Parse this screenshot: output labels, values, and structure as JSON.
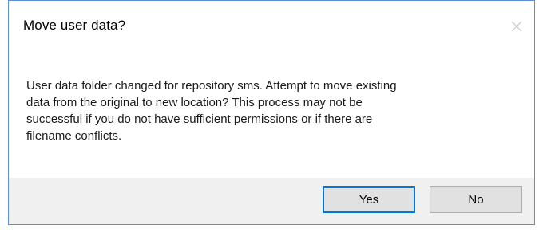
{
  "dialog": {
    "title": "Move user data?",
    "close_icon": "close-icon",
    "message": "User data folder changed for repository sms.  Attempt to move existing\ndata from the original to new location?  This process may not be\nsuccessful if you do not have sufficient permissions or if there are\nfilename conflicts.",
    "buttons": {
      "yes_label": "Yes",
      "no_label": "No"
    },
    "colors": {
      "border": "#5b8fd6",
      "default_button_border": "#0078d7",
      "footer_background": "#f0f0f0",
      "button_background": "#e1e1e1"
    }
  }
}
